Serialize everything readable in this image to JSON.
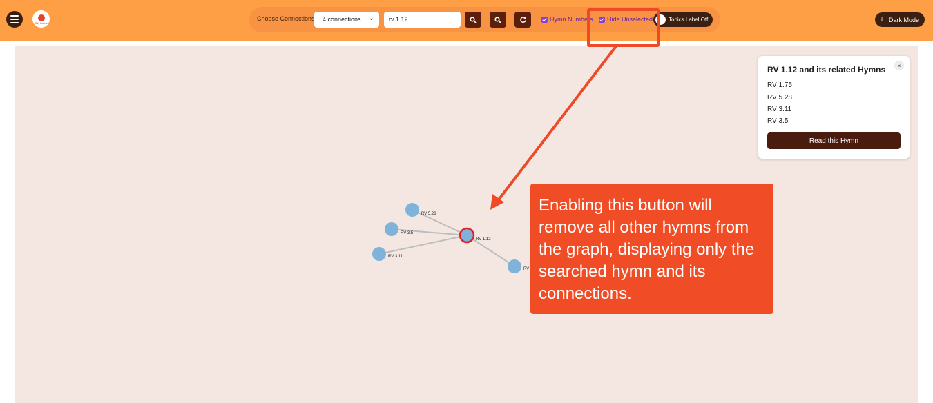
{
  "header": {
    "logo_text": "RVHymns"
  },
  "toolbar": {
    "connections_label": "Choose Connections:",
    "connections_value": "4 connections",
    "search_value": "rv 1.12",
    "hymn_numbers_label": "Hymn Numbers",
    "hide_unselected_label": "Hide Unselected",
    "topics_toggle_label": "Topics Label Off",
    "dark_mode_label": "Dark Mode"
  },
  "graph": {
    "selected_label": "RV 1.12",
    "nodes": [
      "RV 5.28",
      "RV 3.5",
      "RV 3.11",
      "RV"
    ]
  },
  "card": {
    "title": "RV 1.12 and its related Hymns",
    "close": "×",
    "items": [
      "RV 1.75",
      "RV 5.28",
      "RV 3.11",
      "RV 3.5"
    ],
    "button": "Read this Hymn"
  },
  "annotation": {
    "text": "Enabling this button will remove all other hymns from the graph, displaying only the searched hymn and its connections.",
    "color": "#f04d27"
  },
  "colors": {
    "topbar": "#fe9f45",
    "canvas": "#f4e6e1",
    "node": "#7fb3d9",
    "selected_ring": "#e0202a",
    "dark": "#3b1f10"
  }
}
